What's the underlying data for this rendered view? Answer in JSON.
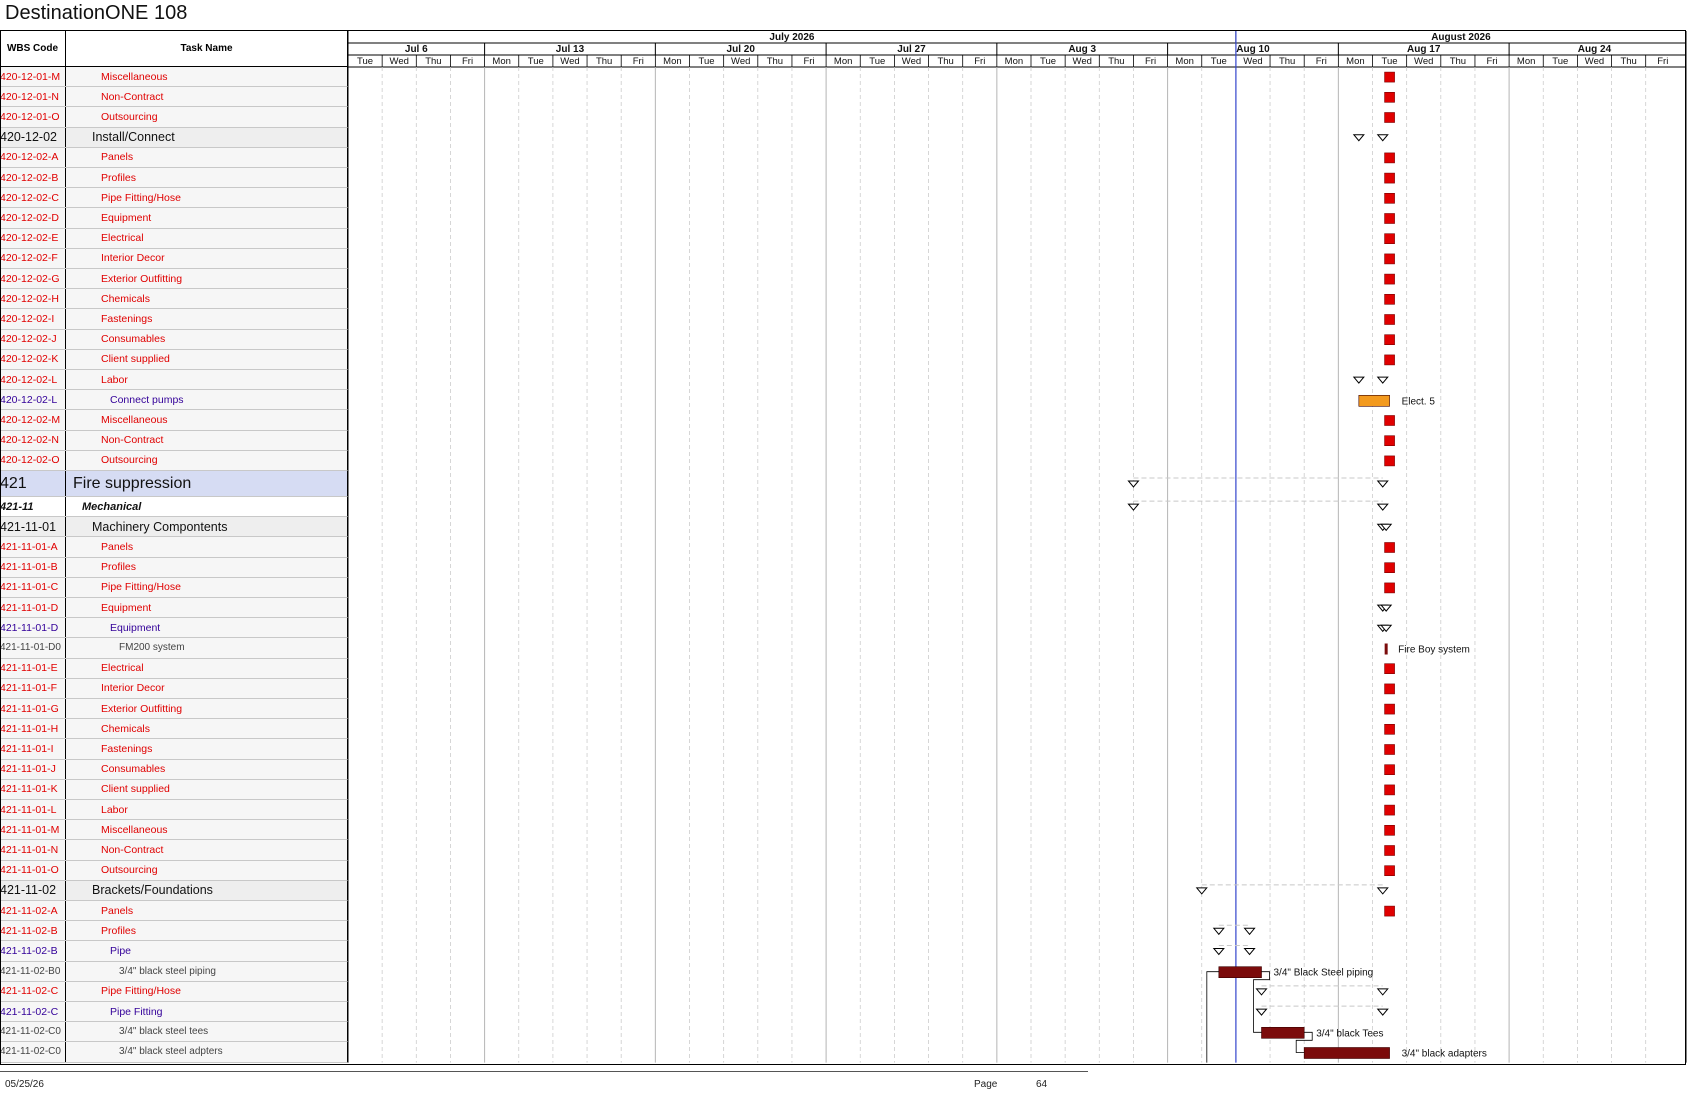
{
  "document": {
    "title": "DestinationONE 108"
  },
  "columns": {
    "wbs": "WBS Code",
    "task": "Task Name"
  },
  "timescale": {
    "months": [
      {
        "label": "July 2026",
        "first_day": 0,
        "last_day": 25
      },
      {
        "label": "August 2026",
        "first_day": 26,
        "last_day": 52
      }
    ],
    "weeks": [
      {
        "label": "Jul 6",
        "first_day": 0,
        "last_day": 3
      },
      {
        "label": "Jul 13",
        "first_day": 4,
        "last_day": 8
      },
      {
        "label": "Jul 20",
        "first_day": 9,
        "last_day": 13
      },
      {
        "label": "Jul 27",
        "first_day": 14,
        "last_day": 18
      },
      {
        "label": "Aug 3",
        "first_day": 19,
        "last_day": 23
      },
      {
        "label": "Aug 10",
        "first_day": 24,
        "last_day": 28
      },
      {
        "label": "Aug 17",
        "first_day": 29,
        "last_day": 33
      },
      {
        "label": "Aug 24",
        "first_day": 34,
        "last_day": 38
      }
    ],
    "days": [
      "Tue",
      "Wed",
      "Thu",
      "Fri",
      "Mon",
      "Tue",
      "Wed",
      "Thu",
      "Fri",
      "Mon",
      "Tue",
      "Wed",
      "Thu",
      "Fri",
      "Mon",
      "Tue",
      "Wed",
      "Thu",
      "Fri",
      "Mon",
      "Tue",
      "Wed",
      "Thu",
      "Fri",
      "Mon",
      "Tue",
      "Wed",
      "Thu",
      "Fri",
      "Mon",
      "Tue",
      "Wed",
      "Thu",
      "Fri",
      "Mon",
      "Tue",
      "Wed",
      "Thu",
      "Fri"
    ]
  },
  "tasks": [
    {
      "wbs": "420-12-01-M",
      "name": "Miscellaneous",
      "style": "red",
      "marker": {
        "type": "milestone",
        "day": 30.5
      }
    },
    {
      "wbs": "420-12-01-N",
      "name": "Non-Contract",
      "style": "red",
      "marker": {
        "type": "milestone",
        "day": 30.5
      }
    },
    {
      "wbs": "420-12-01-O",
      "name": "Outsourcing",
      "style": "red",
      "marker": {
        "type": "milestone",
        "day": 30.5
      }
    },
    {
      "wbs": "420-12-02",
      "name": "Install/Connect",
      "style": "sum",
      "marker": {
        "type": "summary",
        "start": 29.6,
        "end": 30.3
      }
    },
    {
      "wbs": "420-12-02-A",
      "name": "Panels",
      "style": "red",
      "marker": {
        "type": "milestone",
        "day": 30.5
      }
    },
    {
      "wbs": "420-12-02-B",
      "name": "Profiles",
      "style": "red",
      "marker": {
        "type": "milestone",
        "day": 30.5
      }
    },
    {
      "wbs": "420-12-02-C",
      "name": "Pipe Fitting/Hose",
      "style": "red",
      "marker": {
        "type": "milestone",
        "day": 30.5
      }
    },
    {
      "wbs": "420-12-02-D",
      "name": "Equipment",
      "style": "red",
      "marker": {
        "type": "milestone",
        "day": 30.5
      }
    },
    {
      "wbs": "420-12-02-E",
      "name": "Electrical",
      "style": "red",
      "marker": {
        "type": "milestone",
        "day": 30.5
      }
    },
    {
      "wbs": "420-12-02-F",
      "name": "Interior Decor",
      "style": "red",
      "marker": {
        "type": "milestone",
        "day": 30.5
      }
    },
    {
      "wbs": "420-12-02-G",
      "name": "Exterior Outfitting",
      "style": "red",
      "marker": {
        "type": "milestone",
        "day": 30.5
      }
    },
    {
      "wbs": "420-12-02-H",
      "name": "Chemicals",
      "style": "red",
      "marker": {
        "type": "milestone",
        "day": 30.5
      }
    },
    {
      "wbs": "420-12-02-I",
      "name": "Fastenings",
      "style": "red",
      "marker": {
        "type": "milestone",
        "day": 30.5
      }
    },
    {
      "wbs": "420-12-02-J",
      "name": "Consumables",
      "style": "red",
      "marker": {
        "type": "milestone",
        "day": 30.5
      }
    },
    {
      "wbs": "420-12-02-K",
      "name": "Client supplied",
      "style": "red",
      "marker": {
        "type": "milestone",
        "day": 30.5
      }
    },
    {
      "wbs": "420-12-02-L",
      "name": "Labor",
      "style": "red",
      "marker": {
        "type": "summary",
        "start": 29.6,
        "end": 30.3
      }
    },
    {
      "wbs": "420-12-02-L",
      "name": "Connect pumps",
      "style": "purple",
      "marker": {
        "type": "bar",
        "start": 29.6,
        "end": 30.5,
        "color": "#f39a1e",
        "label": "Elect. 5"
      }
    },
    {
      "wbs": "420-12-02-M",
      "name": "Miscellaneous",
      "style": "red",
      "marker": {
        "type": "milestone",
        "day": 30.5
      }
    },
    {
      "wbs": "420-12-02-N",
      "name": "Non-Contract",
      "style": "red",
      "marker": {
        "type": "milestone",
        "day": 30.5
      }
    },
    {
      "wbs": "420-12-02-O",
      "name": "Outsourcing",
      "style": "red",
      "marker": {
        "type": "milestone",
        "day": 30.5
      }
    },
    {
      "wbs": "421",
      "name": "Fire suppression",
      "style": "big",
      "marker": {
        "type": "summary",
        "start": 23.0,
        "end": 30.3
      }
    },
    {
      "wbs": "421-11",
      "name": "Mechanical",
      "style": "bold",
      "marker": {
        "type": "summary",
        "start": 23.0,
        "end": 30.3
      }
    },
    {
      "wbs": "421-11-01",
      "name": "Machinery Compontents",
      "style": "sum",
      "marker": {
        "type": "summary",
        "start": 30.3,
        "end": 30.4
      }
    },
    {
      "wbs": "421-11-01-A",
      "name": "Panels",
      "style": "red",
      "marker": {
        "type": "milestone",
        "day": 30.5
      }
    },
    {
      "wbs": "421-11-01-B",
      "name": "Profiles",
      "style": "red",
      "marker": {
        "type": "milestone",
        "day": 30.5
      }
    },
    {
      "wbs": "421-11-01-C",
      "name": "Pipe Fitting/Hose",
      "style": "red",
      "marker": {
        "type": "milestone",
        "day": 30.5
      }
    },
    {
      "wbs": "421-11-01-D",
      "name": "Equipment",
      "style": "red",
      "marker": {
        "type": "summary",
        "start": 30.3,
        "end": 30.4
      }
    },
    {
      "wbs": "421-11-01-D",
      "name": "Equipment",
      "style": "purple",
      "marker": {
        "type": "summary",
        "start": 30.3,
        "end": 30.4
      }
    },
    {
      "wbs": "421-11-01-D0",
      "name": "FM200 system",
      "style": "grey",
      "marker": {
        "type": "thin",
        "day": 30.4,
        "label": "Fire Boy system"
      }
    },
    {
      "wbs": "421-11-01-E",
      "name": "Electrical",
      "style": "red",
      "marker": {
        "type": "milestone",
        "day": 30.5
      }
    },
    {
      "wbs": "421-11-01-F",
      "name": "Interior Decor",
      "style": "red",
      "marker": {
        "type": "milestone",
        "day": 30.5
      }
    },
    {
      "wbs": "421-11-01-G",
      "name": "Exterior Outfitting",
      "style": "red",
      "marker": {
        "type": "milestone",
        "day": 30.5
      }
    },
    {
      "wbs": "421-11-01-H",
      "name": "Chemicals",
      "style": "red",
      "marker": {
        "type": "milestone",
        "day": 30.5
      }
    },
    {
      "wbs": "421-11-01-I",
      "name": "Fastenings",
      "style": "red",
      "marker": {
        "type": "milestone",
        "day": 30.5
      }
    },
    {
      "wbs": "421-11-01-J",
      "name": "Consumables",
      "style": "red",
      "marker": {
        "type": "milestone",
        "day": 30.5
      }
    },
    {
      "wbs": "421-11-01-K",
      "name": "Client supplied",
      "style": "red",
      "marker": {
        "type": "milestone",
        "day": 30.5
      }
    },
    {
      "wbs": "421-11-01-L",
      "name": "Labor",
      "style": "red",
      "marker": {
        "type": "milestone",
        "day": 30.5
      }
    },
    {
      "wbs": "421-11-01-M",
      "name": "Miscellaneous",
      "style": "red",
      "marker": {
        "type": "milestone",
        "day": 30.5
      }
    },
    {
      "wbs": "421-11-01-N",
      "name": "Non-Contract",
      "style": "red",
      "marker": {
        "type": "milestone",
        "day": 30.5
      }
    },
    {
      "wbs": "421-11-01-O",
      "name": "Outsourcing",
      "style": "red",
      "marker": {
        "type": "milestone",
        "day": 30.5
      }
    },
    {
      "wbs": "421-11-02",
      "name": "Brackets/Foundations",
      "style": "sum",
      "marker": {
        "type": "summary",
        "start": 25.0,
        "end": 30.3
      }
    },
    {
      "wbs": "421-11-02-A",
      "name": "Panels",
      "style": "red",
      "marker": {
        "type": "milestone",
        "day": 30.5
      }
    },
    {
      "wbs": "421-11-02-B",
      "name": "Profiles",
      "style": "red",
      "marker": {
        "type": "summary",
        "start": 25.5,
        "end": 26.4
      }
    },
    {
      "wbs": "421-11-02-B",
      "name": "Pipe",
      "style": "purple",
      "marker": {
        "type": "summary",
        "start": 25.5,
        "end": 26.4
      }
    },
    {
      "wbs": "421-11-02-B0",
      "name": "3/4\" black steel piping",
      "style": "grey",
      "marker": {
        "type": "bar",
        "start": 25.5,
        "end": 26.75,
        "color": "#7b0b0b",
        "label": "3/4\" Black Steel piping"
      }
    },
    {
      "wbs": "421-11-02-C",
      "name": "Pipe Fitting/Hose",
      "style": "red",
      "marker": {
        "type": "summary",
        "start": 26.75,
        "end": 30.3
      }
    },
    {
      "wbs": "421-11-02-C",
      "name": "Pipe Fitting",
      "style": "purple",
      "marker": {
        "type": "summary",
        "start": 26.75,
        "end": 30.3
      }
    },
    {
      "wbs": "421-11-02-C0",
      "name": "3/4\" black steel tees",
      "style": "grey",
      "marker": {
        "type": "bar",
        "start": 26.75,
        "end": 28.0,
        "color": "#7b0b0b",
        "label": "3/4\" black Tees"
      }
    },
    {
      "wbs": "421-11-02-C0",
      "name": "3/4\" black steel adpters",
      "style": "grey",
      "marker": {
        "type": "bar",
        "start": 28.0,
        "end": 30.5,
        "color": "#7b0b0b",
        "label": "3/4\" black adapters"
      }
    }
  ],
  "footer": {
    "date": "05/25/26",
    "page_label": "Page",
    "page_number": "64"
  },
  "colors": {
    "milestone": "#e00000",
    "grid": "#bbbbbb",
    "today_line": "#3344cc"
  }
}
